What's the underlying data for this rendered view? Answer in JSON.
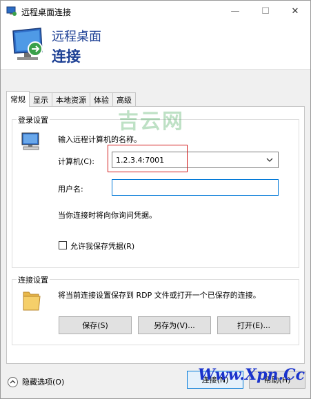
{
  "window": {
    "title": "远程桌面连接",
    "minimize": "—",
    "maximize": "☐",
    "close": "✕"
  },
  "banner": {
    "line1": "远程桌面",
    "line2": "连接"
  },
  "tabs": [
    {
      "label": "常规",
      "active": true
    },
    {
      "label": "显示"
    },
    {
      "label": "本地资源"
    },
    {
      "label": "体验"
    },
    {
      "label": "高级"
    }
  ],
  "login": {
    "group_title": "登录设置",
    "instruction": "输入远程计算机的名称。",
    "computer_label": "计算机(C):",
    "computer_value": "1.2.3.4:7001",
    "username_label": "用户名:",
    "username_value": "",
    "ask_text": "当你连接时将向你询问凭据。",
    "allow_save_label": "允许我保存凭据(R)"
  },
  "connection": {
    "group_title": "连接设置",
    "description": "将当前连接设置保存到 RDP 文件或打开一个已保存的连接。",
    "save_label": "保存(S)",
    "saveas_label": "另存为(V)...",
    "open_label": "打开(E)..."
  },
  "footer": {
    "hide_options": "隐藏选项(O)",
    "connect": "连接(N)",
    "help": "帮助(H)"
  },
  "watermarks": {
    "center": "吉云网",
    "bottom": "Www.Xpn.Cc"
  },
  "colors": {
    "banner_text": "#1c3f94",
    "highlight": "#d21a1a",
    "focus": "#0078d7"
  }
}
